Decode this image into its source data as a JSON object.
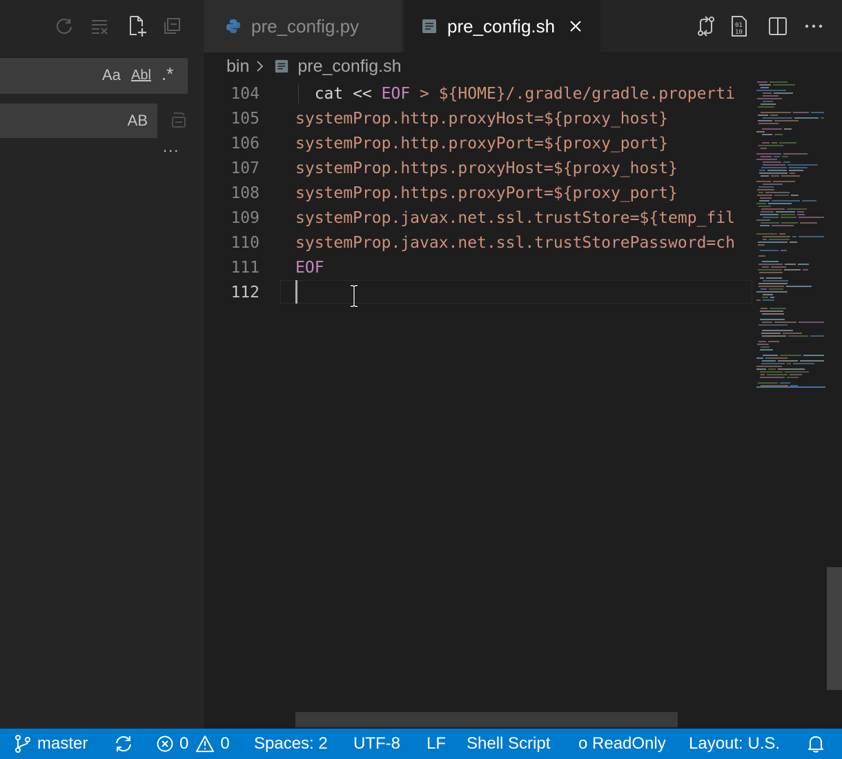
{
  "tabs": [
    {
      "label": "pre_config.py",
      "icon": "python-icon",
      "active": false
    },
    {
      "label": "pre_config.sh",
      "icon": "shell-file-icon",
      "active": true
    }
  ],
  "breadcrumb": {
    "folder": "bin",
    "file": "pre_config.sh"
  },
  "search": {
    "match_case_label": "Aa",
    "whole_word_label": "Abl",
    "regex_label": ".*",
    "preserve_case_label": "AB",
    "more_label": "..."
  },
  "editor": {
    "lines": [
      {
        "number": "104",
        "segments": [
          {
            "text": "  cat << ",
            "cls": "t-cmd"
          },
          {
            "text": "EOF",
            "cls": "t-kw"
          },
          {
            "text": " > ${HOME}/.gradle/gradle.properti",
            "cls": "t-str"
          }
        ]
      },
      {
        "number": "105",
        "segments": [
          {
            "text": "systemProp.http.proxyHost=${proxy_host}",
            "cls": "t-str"
          }
        ]
      },
      {
        "number": "106",
        "segments": [
          {
            "text": "systemProp.http.proxyPort=${proxy_port}",
            "cls": "t-str"
          }
        ]
      },
      {
        "number": "107",
        "segments": [
          {
            "text": "systemProp.https.proxyHost=${proxy_host}",
            "cls": "t-str"
          }
        ]
      },
      {
        "number": "108",
        "segments": [
          {
            "text": "systemProp.https.proxyPort=${proxy_port}",
            "cls": "t-str"
          }
        ]
      },
      {
        "number": "109",
        "segments": [
          {
            "text": "systemProp.javax.net.ssl.trustStore=${temp_fil",
            "cls": "t-str"
          }
        ]
      },
      {
        "number": "110",
        "segments": [
          {
            "text": "systemProp.javax.net.ssl.trustStorePassword=ch",
            "cls": "t-str"
          }
        ]
      },
      {
        "number": "111",
        "segments": [
          {
            "text": "EOF",
            "cls": "t-kw"
          }
        ]
      },
      {
        "number": "112",
        "segments": [
          {
            "text": "",
            "cls": "t-cmd"
          }
        ]
      }
    ]
  },
  "status": {
    "branch": "master",
    "errors": "0",
    "warnings": "0",
    "indent": "Spaces: 2",
    "encoding": "UTF-8",
    "eol": "LF",
    "language": "Shell Script",
    "readonly": "o ReadOnly",
    "layout": "Layout: U.S."
  },
  "colors": {
    "statusbar": "#007acc",
    "string": "#ce9178",
    "keyword": "#c586c0",
    "editor_bg": "#1e1e1e",
    "sidebar_bg": "#252526"
  }
}
